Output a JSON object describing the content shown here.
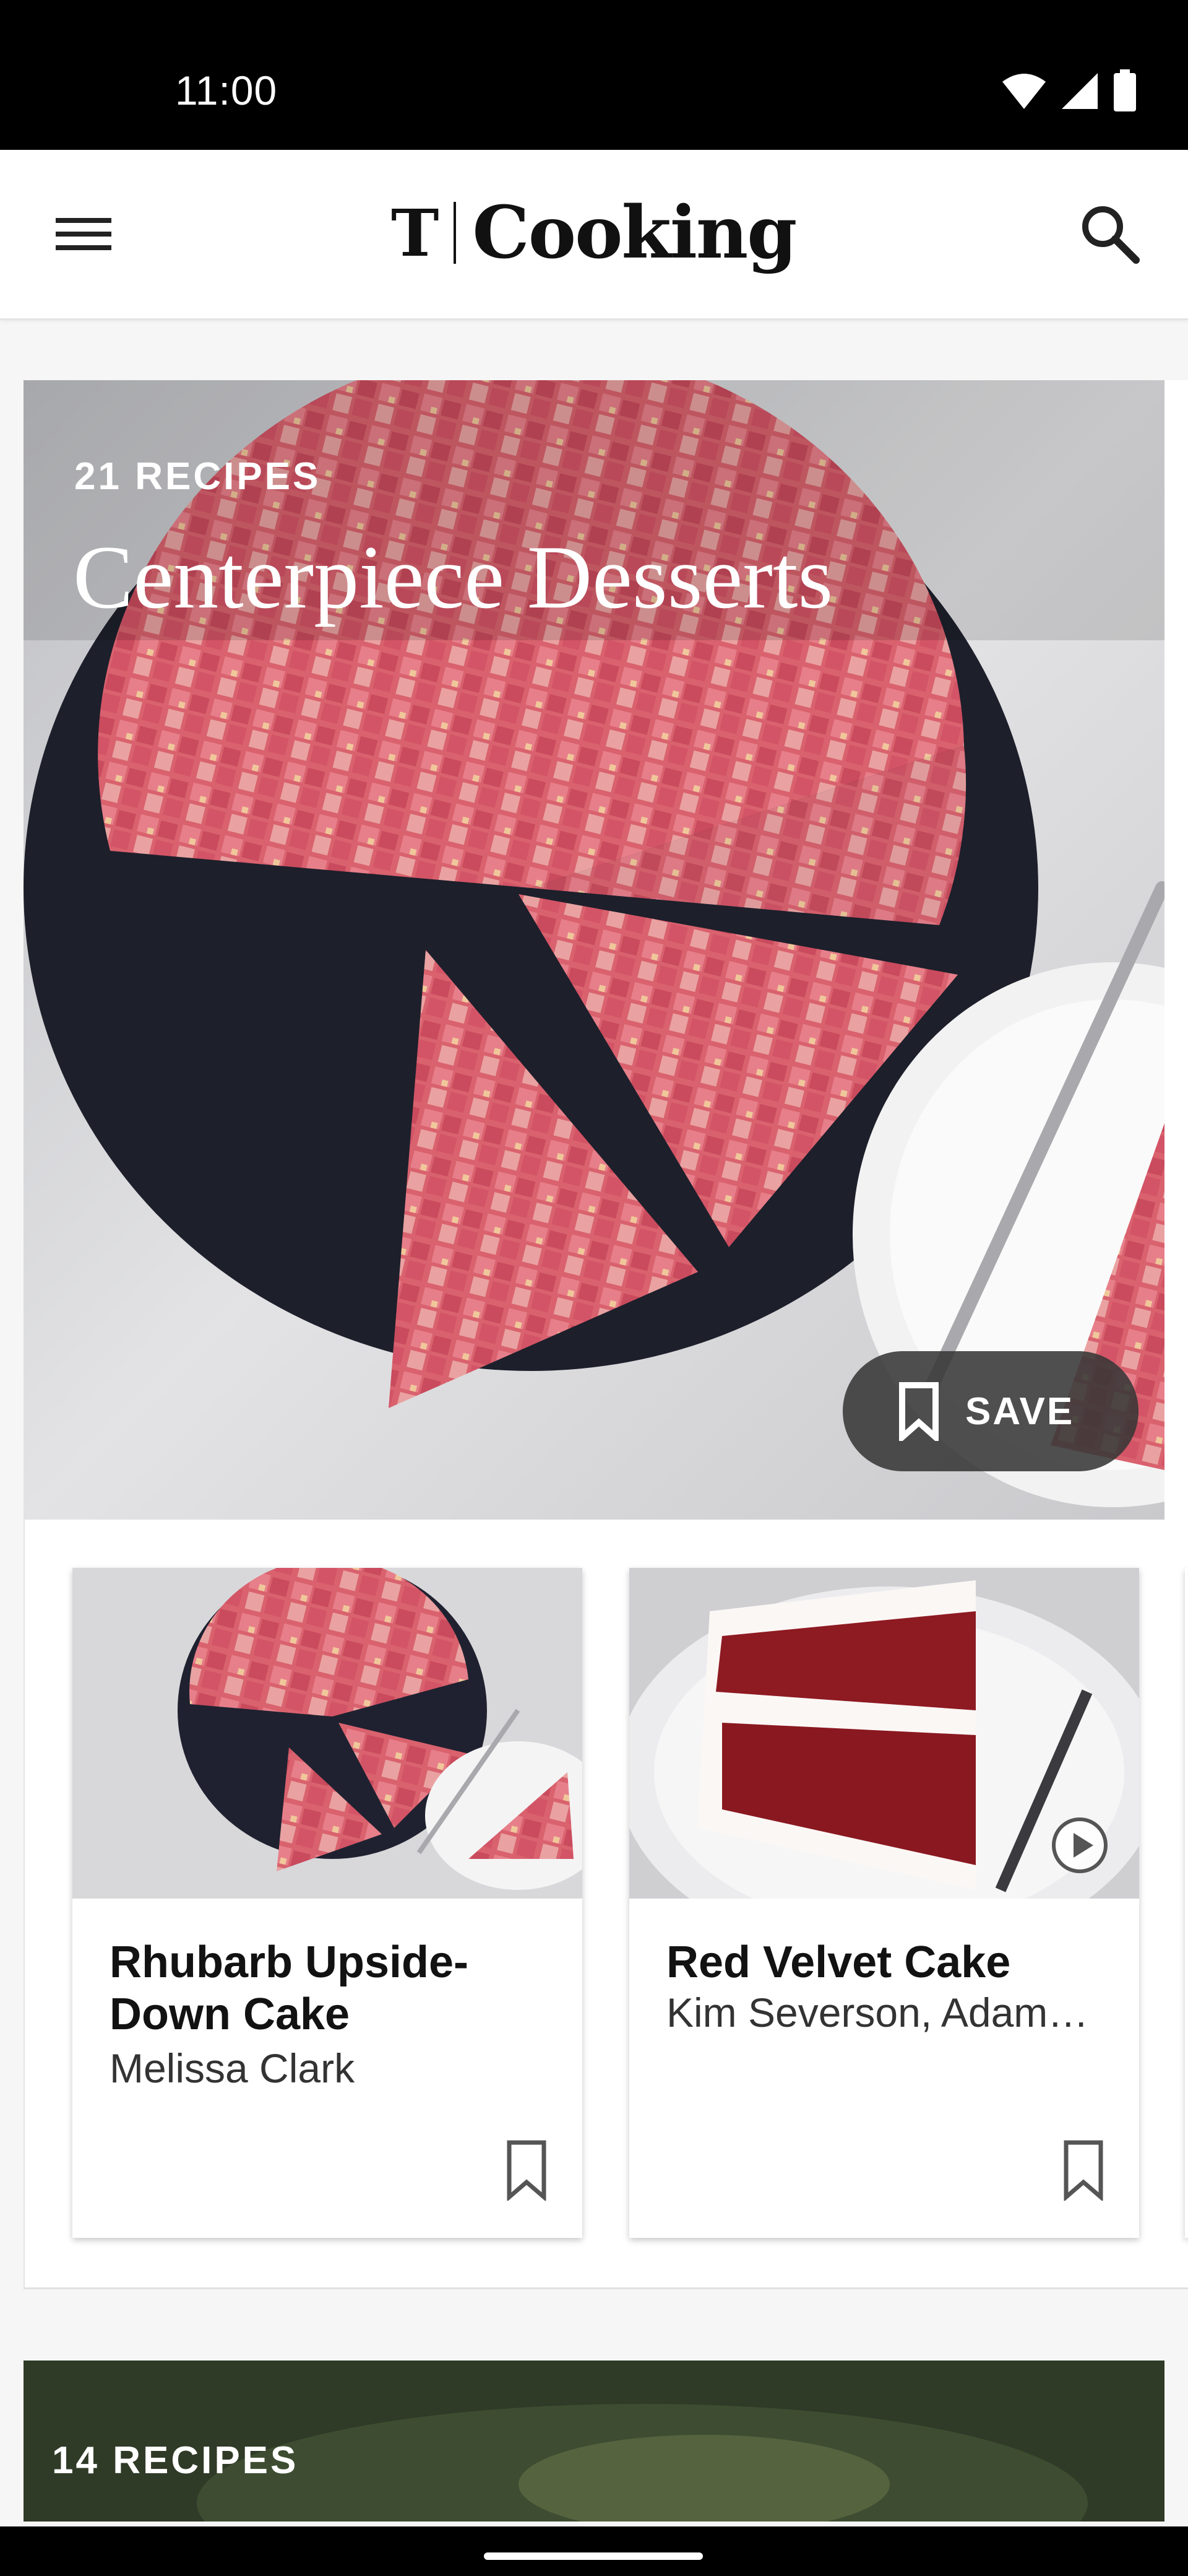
{
  "status_bar": {
    "time": "11:00"
  },
  "app_bar": {
    "brand_mark": "T",
    "brand_word": "Cooking"
  },
  "hero": {
    "recipe_count": "21 RECIPES",
    "title": "Centerpiece Desserts",
    "save_label": "SAVE"
  },
  "recipes": [
    {
      "title": "Rhubarb Upside-Down Cake",
      "author": "Melissa Clark",
      "has_video": false
    },
    {
      "title": "Red Velvet Cake",
      "author": "Kim Severson, Adam…",
      "has_video": true
    }
  ],
  "next_collection": {
    "recipe_count": "14 RECIPES"
  },
  "colors": {
    "status_bar": "#000000",
    "app_bar": "#ffffff",
    "pill": "#373737"
  }
}
